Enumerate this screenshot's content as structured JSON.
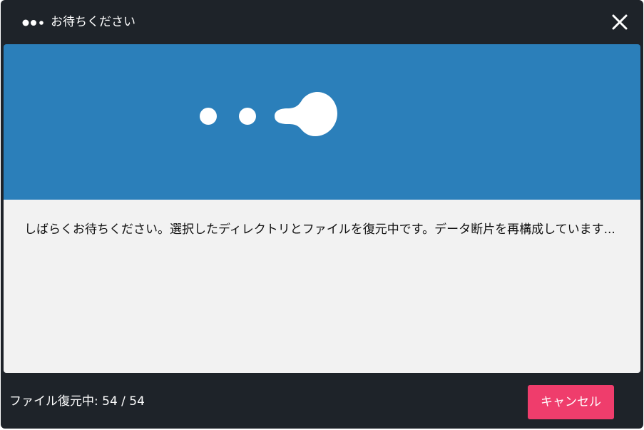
{
  "dialog": {
    "title": "お待ちください",
    "close_icon": "close-icon",
    "title_icon": "loading-dots-icon"
  },
  "banner": {
    "icon": "loading-dots-icon",
    "background_color": "#2b7fba"
  },
  "content": {
    "message": "しばらくお待ちください。選択したディレクトリとファイルを復元中です。データ断片を再構成しています..."
  },
  "footer": {
    "status": "ファイル復元中: 54 / 54",
    "cancel_label": "キャンセル",
    "cancel_color": "#ef3d6c"
  }
}
